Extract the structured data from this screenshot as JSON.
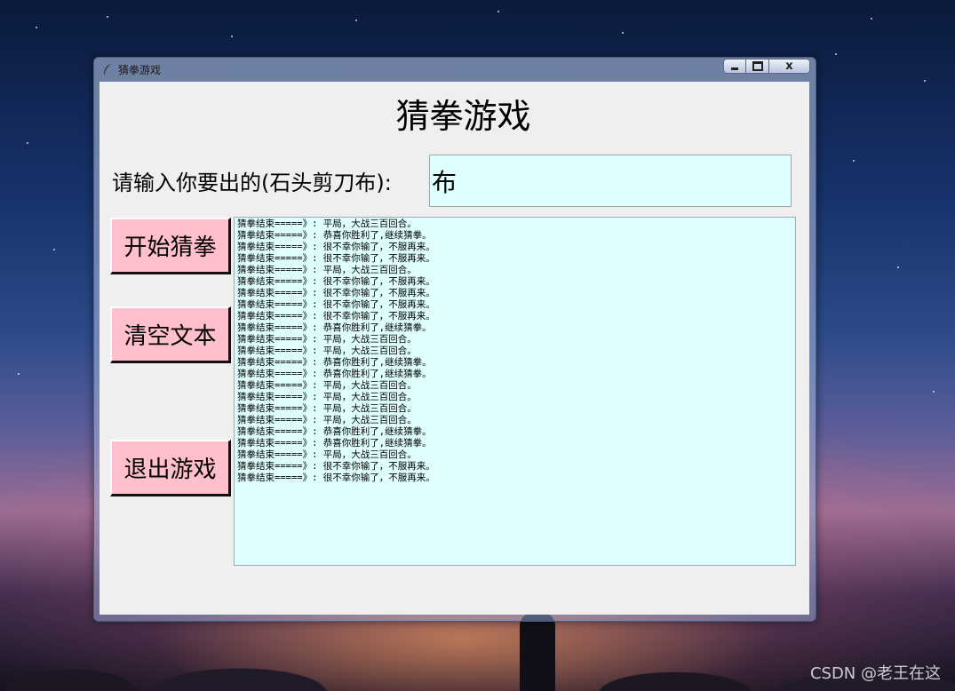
{
  "window": {
    "title": "猜拳游戏",
    "controls": {
      "minimize": "minimize",
      "maximize": "maximize",
      "close": "close"
    }
  },
  "game": {
    "heading": "猜拳游戏",
    "prompt_label": "请输入你要出的(石头剪刀布):",
    "entry_value": "布",
    "buttons": {
      "start": "开始猜拳",
      "clear": "清空文本",
      "quit": "退出游戏"
    },
    "log": [
      "猜拳结束=====》: 平局，大战三百回合。",
      "猜拳结束=====》: 恭喜你胜利了,继续猜拳。",
      "猜拳结束=====》: 很不幸你输了，不服再来。",
      "猜拳结束=====》: 很不幸你输了，不服再来。",
      "猜拳结束=====》: 平局，大战三百回合。",
      "猜拳结束=====》: 很不幸你输了，不服再来。",
      "猜拳结束=====》: 很不幸你输了，不服再来。",
      "猜拳结束=====》: 很不幸你输了，不服再来。",
      "猜拳结束=====》: 很不幸你输了，不服再来。",
      "猜拳结束=====》: 恭喜你胜利了,继续猜拳。",
      "猜拳结束=====》: 平局，大战三百回合。",
      "猜拳结束=====》: 平局，大战三百回合。",
      "猜拳结束=====》: 恭喜你胜利了,继续猜拳。",
      "猜拳结束=====》: 恭喜你胜利了,继续猜拳。",
      "猜拳结束=====》: 平局，大战三百回合。",
      "猜拳结束=====》: 平局，大战三百回合。",
      "猜拳结束=====》: 平局，大战三百回合。",
      "猜拳结束=====》: 平局，大战三百回合。",
      "猜拳结束=====》: 恭喜你胜利了,继续猜拳。",
      "猜拳结束=====》: 恭喜你胜利了,继续猜拳。",
      "猜拳结束=====》: 平局，大战三百回合。",
      "猜拳结束=====》: 很不幸你输了，不服再来。",
      "猜拳结束=====》: 很不幸你输了，不服再来。"
    ]
  },
  "watermark": "CSDN @老王在这",
  "colors": {
    "button_bg": "#ffc0cb",
    "field_bg": "#dfffff",
    "client_bg": "#efefef"
  },
  "icons": {
    "app_icon": "feather-icon"
  }
}
